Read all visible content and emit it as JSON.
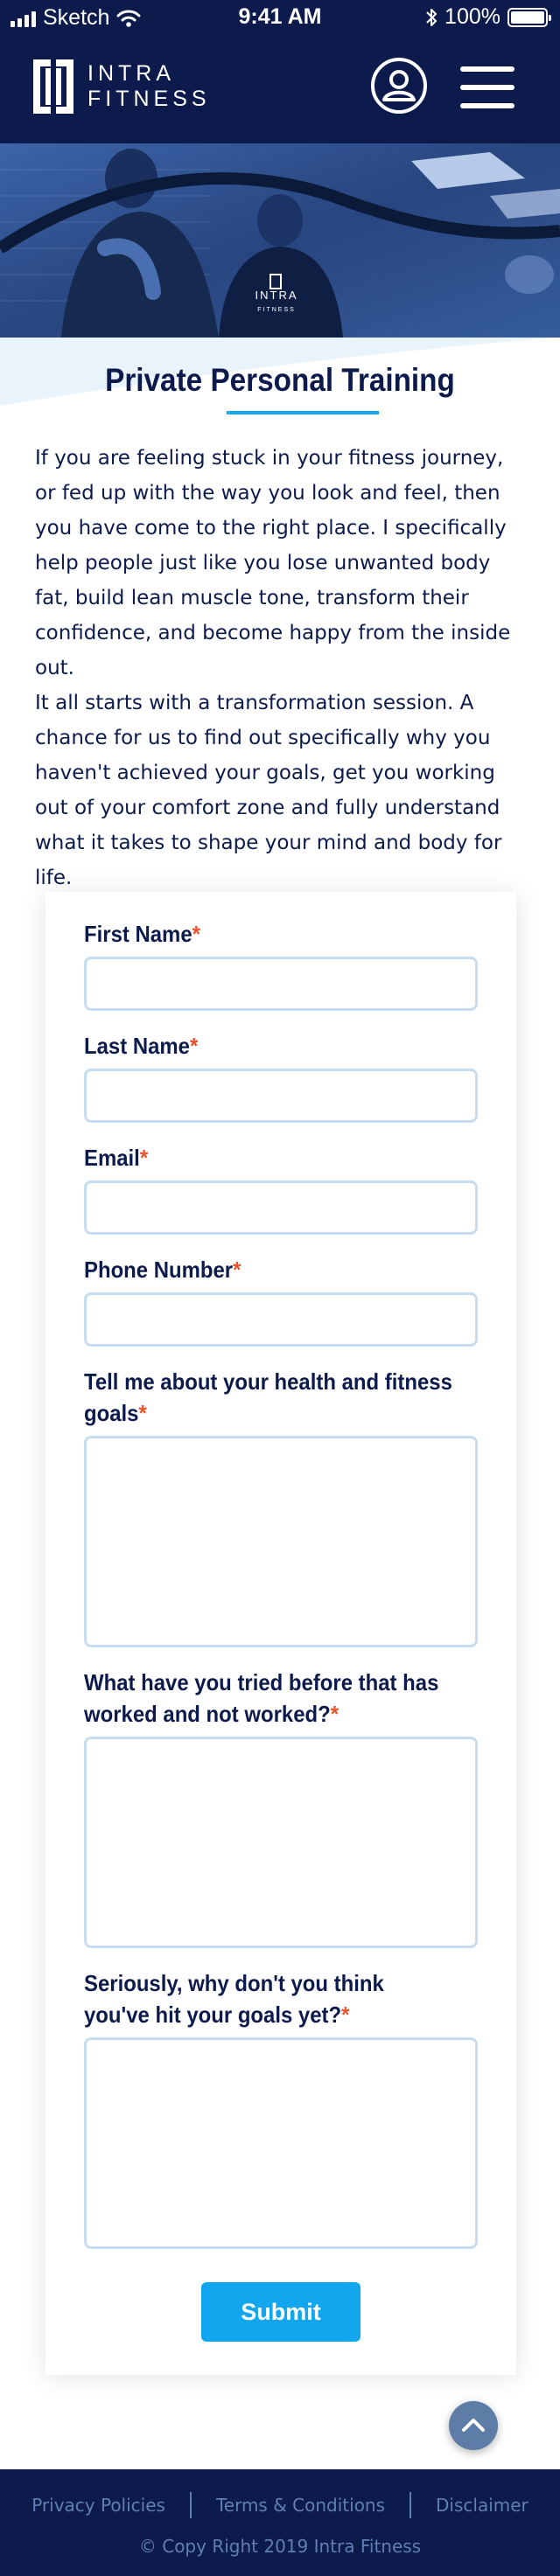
{
  "status_bar": {
    "carrier": "Sketch",
    "time": "9:41 AM",
    "battery_percent": "100%",
    "battery_level": 1.0,
    "icons": [
      "signal-icon",
      "wifi-icon",
      "bluetooth-icon",
      "battery-icon"
    ]
  },
  "header": {
    "logo_line1": "INTRA",
    "logo_line2": "FITNESS",
    "icons": [
      "intra-fitness-logo-icon",
      "account-icon",
      "hamburger-menu-icon"
    ]
  },
  "hero": {
    "shirt_logo_line1": "INTRA",
    "shirt_logo_line2": "FITNESS",
    "tint_color": "#2c4d8c"
  },
  "intro": {
    "title": "Private Personal Training",
    "paragraph_1": "If you are feeling stuck in your fitness journey, or fed up with the way you look and feel, then you have come to the right place. I specifically help people just like you lose unwanted body fat, build lean muscle tone, transform their confidence, and become happy from the inside out.",
    "paragraph_2": "It all starts with a transformation session. A chance for us to find out specifically why you haven't achieved your goals, get you working out of your comfort zone and fully understand what it takes to shape your mind and body for life."
  },
  "form": {
    "required_marker": "*",
    "fields": [
      {
        "label": "First Name",
        "value": ""
      },
      {
        "label": "Last Name",
        "value": ""
      },
      {
        "label": "Email",
        "value": ""
      },
      {
        "label": "Phone Number",
        "value": ""
      },
      {
        "label": "Tell me about your health and fitness goals",
        "value": ""
      },
      {
        "label": "What have you tried before that has worked and not worked?",
        "value": ""
      },
      {
        "label": "Seriously, why don't you think you've hit your goals yet?",
        "value": ""
      }
    ],
    "submit_label": "Submit"
  },
  "footer": {
    "links": [
      "Privacy Policies",
      "Terms & Conditions",
      "Disclaimer"
    ],
    "copyright": "© Copy Right 2019 Intra Fitness"
  },
  "colors": {
    "navy": "#0d1b4c",
    "accent_blue": "#17a9ea",
    "required_red": "#e8532c",
    "input_border": "#c6dcef",
    "footer_text": "#5f7fb1"
  }
}
